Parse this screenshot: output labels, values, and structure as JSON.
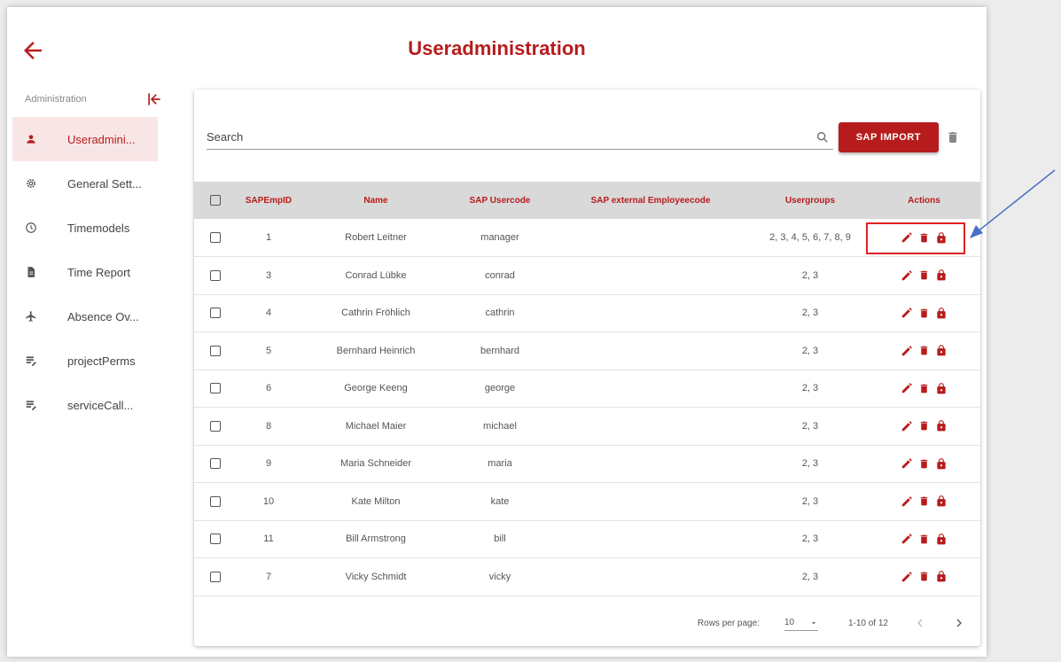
{
  "header": {
    "title": "Useradministration"
  },
  "sidebar": {
    "heading": "Administration",
    "items": [
      {
        "label": "Useradmini...",
        "icon": "person-icon",
        "active": true
      },
      {
        "label": "General Sett...",
        "icon": "gear-icon",
        "active": false
      },
      {
        "label": "Timemodels",
        "icon": "clock-icon",
        "active": false
      },
      {
        "label": "Time Report",
        "icon": "document-icon",
        "active": false
      },
      {
        "label": "Absence Ov...",
        "icon": "airplane-icon",
        "active": false
      },
      {
        "label": "projectPerms",
        "icon": "list-edit-icon",
        "active": false
      },
      {
        "label": "serviceCall...",
        "icon": "list-edit-icon",
        "active": false
      }
    ]
  },
  "toolbar": {
    "search_placeholder": "Search",
    "sap_import_label": "SAP IMPORT"
  },
  "table": {
    "columns": [
      "SAPEmpID",
      "Name",
      "SAP Usercode",
      "SAP external Employeecode",
      "Usergroups",
      "Actions"
    ],
    "rows": [
      {
        "id": "1",
        "name": "Robert Leitner",
        "usercode": "manager",
        "external": "",
        "groups": "2, 3, 4, 5, 6, 7, 8, 9"
      },
      {
        "id": "3",
        "name": "Conrad Lübke",
        "usercode": "conrad",
        "external": "",
        "groups": "2, 3"
      },
      {
        "id": "4",
        "name": "Cathrin Fröhlich",
        "usercode": "cathrin",
        "external": "",
        "groups": "2, 3"
      },
      {
        "id": "5",
        "name": "Bernhard Heinrich",
        "usercode": "bernhard",
        "external": "",
        "groups": "2, 3"
      },
      {
        "id": "6",
        "name": "George Keeng",
        "usercode": "george",
        "external": "",
        "groups": "2, 3"
      },
      {
        "id": "8",
        "name": "Michael Maier",
        "usercode": "michael",
        "external": "",
        "groups": "2, 3"
      },
      {
        "id": "9",
        "name": "Maria Schneider",
        "usercode": "maria",
        "external": "",
        "groups": "2, 3"
      },
      {
        "id": "10",
        "name": "Kate Milton",
        "usercode": "kate",
        "external": "",
        "groups": "2, 3"
      },
      {
        "id": "11",
        "name": "Bill Armstrong",
        "usercode": "bill",
        "external": "",
        "groups": "2, 3"
      },
      {
        "id": "7",
        "name": "Vicky Schmidt",
        "usercode": "vicky",
        "external": "",
        "groups": "2, 3"
      }
    ]
  },
  "pagination": {
    "rows_per_page_label": "Rows per page:",
    "rows_per_page_value": "10",
    "range": "1-10 of 12"
  },
  "colors": {
    "accent": "#b71c1c",
    "header_bg": "#d9d9d9",
    "active_bg": "#f8e6e6"
  }
}
